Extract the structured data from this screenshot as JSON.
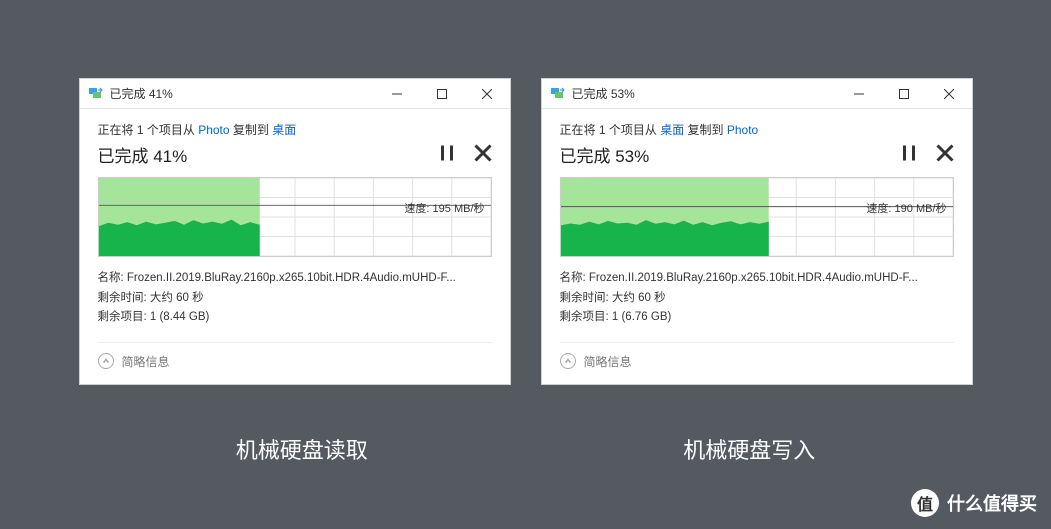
{
  "colors": {
    "chart_light": "#a4e59a",
    "chart_dark": "#16b44b",
    "grid": "#e0e0e0",
    "link": "#0066cc"
  },
  "dialogs": [
    {
      "title": "已完成 41%",
      "copy_prefix": "正在将 1 个项目从 ",
      "copy_source": "Photo",
      "copy_mid": " 复制到 ",
      "copy_dest": "桌面",
      "progress_label": "已完成 41%",
      "speed_label": "速度: 195 MB/秒",
      "file_label": "名称: ",
      "file_name": "Frozen.II.2019.BluRay.2160p.x265.10bit.HDR.4Audio.mUHD-F...",
      "time_remaining_label": "剩余时间: ",
      "time_remaining": "大约 60 秒",
      "items_remaining_label": "剩余项目: ",
      "items_remaining": "1 (8.44 GB)",
      "brief_label": "简略信息",
      "caption": "机械硬盘读取"
    },
    {
      "title": "已完成 53%",
      "copy_prefix": "正在将 1 个项目从 ",
      "copy_source": "桌面",
      "copy_mid": " 复制到 ",
      "copy_dest": "Photo",
      "progress_label": "已完成 53%",
      "speed_label": "速度: 190 MB/秒",
      "file_label": "名称: ",
      "file_name": "Frozen.II.2019.BluRay.2160p.x265.10bit.HDR.4Audio.mUHD-F...",
      "time_remaining_label": "剩余时间: ",
      "time_remaining": "大约 60 秒",
      "items_remaining_label": "剩余项目: ",
      "items_remaining": "1 (6.76 GB)",
      "brief_label": "简略信息",
      "caption": "机械硬盘写入"
    }
  ],
  "watermark": "什么值得买",
  "watermark_badge": "值",
  "chart_data": [
    {
      "type": "area",
      "x_unit": "time-step",
      "y_unit": "MB/s",
      "ylim": [
        0,
        300
      ],
      "progress_fraction": 0.41,
      "avg_line": 195,
      "series": [
        {
          "name": "speed",
          "values": [
            115,
            128,
            120,
            130,
            118,
            132,
            122,
            128,
            135,
            120,
            138,
            125,
            132,
            124,
            140,
            118,
            130,
            120
          ]
        }
      ]
    },
    {
      "type": "area",
      "x_unit": "time-step",
      "y_unit": "MB/s",
      "ylim": [
        0,
        300
      ],
      "progress_fraction": 0.53,
      "avg_line": 190,
      "series": [
        {
          "name": "speed",
          "values": [
            118,
            125,
            120,
            132,
            122,
            135,
            125,
            128,
            120,
            138,
            124,
            130,
            122,
            136,
            120,
            130,
            118,
            128,
            134,
            122,
            130,
            124,
            132
          ]
        }
      ]
    }
  ]
}
